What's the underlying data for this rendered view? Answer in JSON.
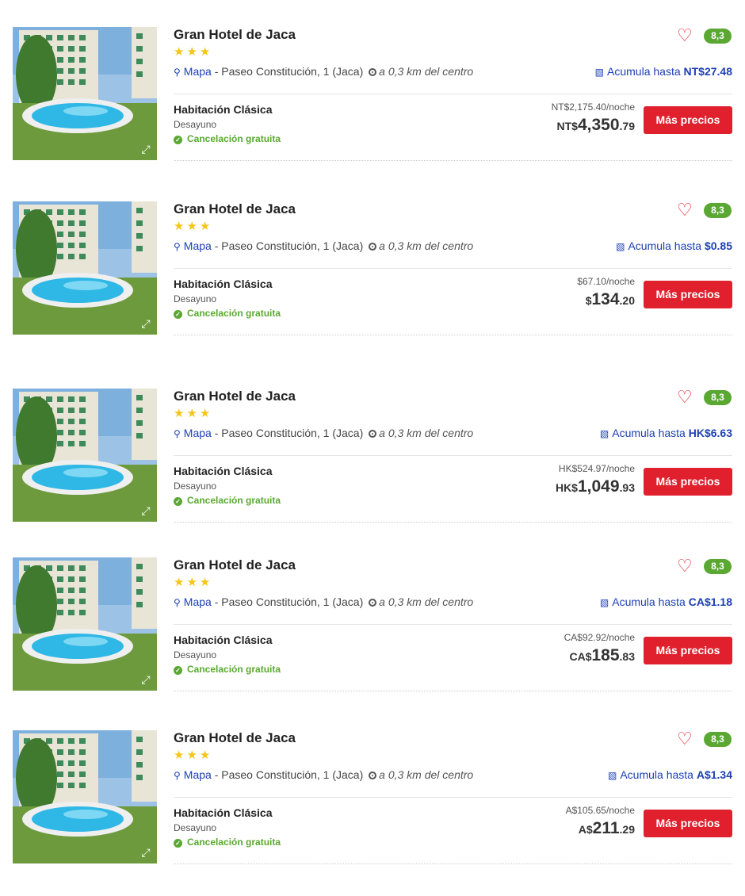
{
  "hotels": [
    {
      "name": "Gran Hotel de Jaca",
      "stars": "★★★",
      "map_label": "Mapa",
      "address": " - Paseo Constitución, 1 (Jaca)",
      "distance": "a 0,3 km del centro",
      "score": "8,3",
      "accum_label": "Acumula hasta",
      "accum_value": "NT$27.48",
      "room": "Habitación Clásica",
      "board": "Desayuno",
      "cancel": "Cancelación gratuita",
      "per_night": "NT$2,175.40/noche",
      "price_cur": "NT$",
      "price_int": "4,350",
      "price_dec": ".79",
      "button": "Más precios"
    },
    {
      "name": "Gran Hotel de Jaca",
      "stars": "★★★",
      "map_label": "Mapa",
      "address": " - Paseo Constitución, 1 (Jaca)",
      "distance": "a 0,3 km del centro",
      "score": "8,3",
      "accum_label": "Acumula hasta",
      "accum_value": "$0.85",
      "room": "Habitación Clásica",
      "board": "Desayuno",
      "cancel": "Cancelación gratuita",
      "per_night": "$67.10/noche",
      "price_cur": "$",
      "price_int": "134",
      "price_dec": ".20",
      "button": "Más precios"
    },
    {
      "name": "Gran Hotel de Jaca",
      "stars": "★★★",
      "map_label": "Mapa",
      "address": " - Paseo Constitución, 1 (Jaca)",
      "distance": "a 0,3 km del centro",
      "score": "8,3",
      "accum_label": "Acumula hasta",
      "accum_value": "HK$6.63",
      "room": "Habitación Clásica",
      "board": "Desayuno",
      "cancel": "Cancelación gratuita",
      "per_night": "HK$524.97/noche",
      "price_cur": "HK$",
      "price_int": "1,049",
      "price_dec": ".93",
      "button": "Más precios"
    },
    {
      "name": "Gran Hotel de Jaca",
      "stars": "★★★",
      "map_label": "Mapa",
      "address": " - Paseo Constitución, 1 (Jaca)",
      "distance": "a 0,3 km del centro",
      "score": "8,3",
      "accum_label": "Acumula hasta",
      "accum_value": "CA$1.18",
      "room": "Habitación Clásica",
      "board": "Desayuno",
      "cancel": "Cancelación gratuita",
      "per_night": "CA$92.92/noche",
      "price_cur": "CA$",
      "price_int": "185",
      "price_dec": ".83",
      "button": "Más precios"
    },
    {
      "name": "Gran Hotel de Jaca",
      "stars": "★★★",
      "map_label": "Mapa",
      "address": " - Paseo Constitución, 1 (Jaca)",
      "distance": "a 0,3 km del centro",
      "score": "8,3",
      "accum_label": "Acumula hasta",
      "accum_value": "A$1.34",
      "room": "Habitación Clásica",
      "board": "Desayuno",
      "cancel": "Cancelación gratuita",
      "per_night": "A$105.65/noche",
      "price_cur": "A$",
      "price_int": "211",
      "price_dec": ".29",
      "button": "Más precios"
    }
  ],
  "colors": {
    "accent": "#e0202d",
    "score": "#5aa832",
    "link": "#1c3fb5",
    "star": "#f5c518"
  },
  "icons": {
    "pin": "map-pin-icon",
    "target": "target-icon",
    "heart": "heart-icon",
    "coins": "coins-icon",
    "check": "check-circle-icon",
    "expand": "expand-icon"
  }
}
